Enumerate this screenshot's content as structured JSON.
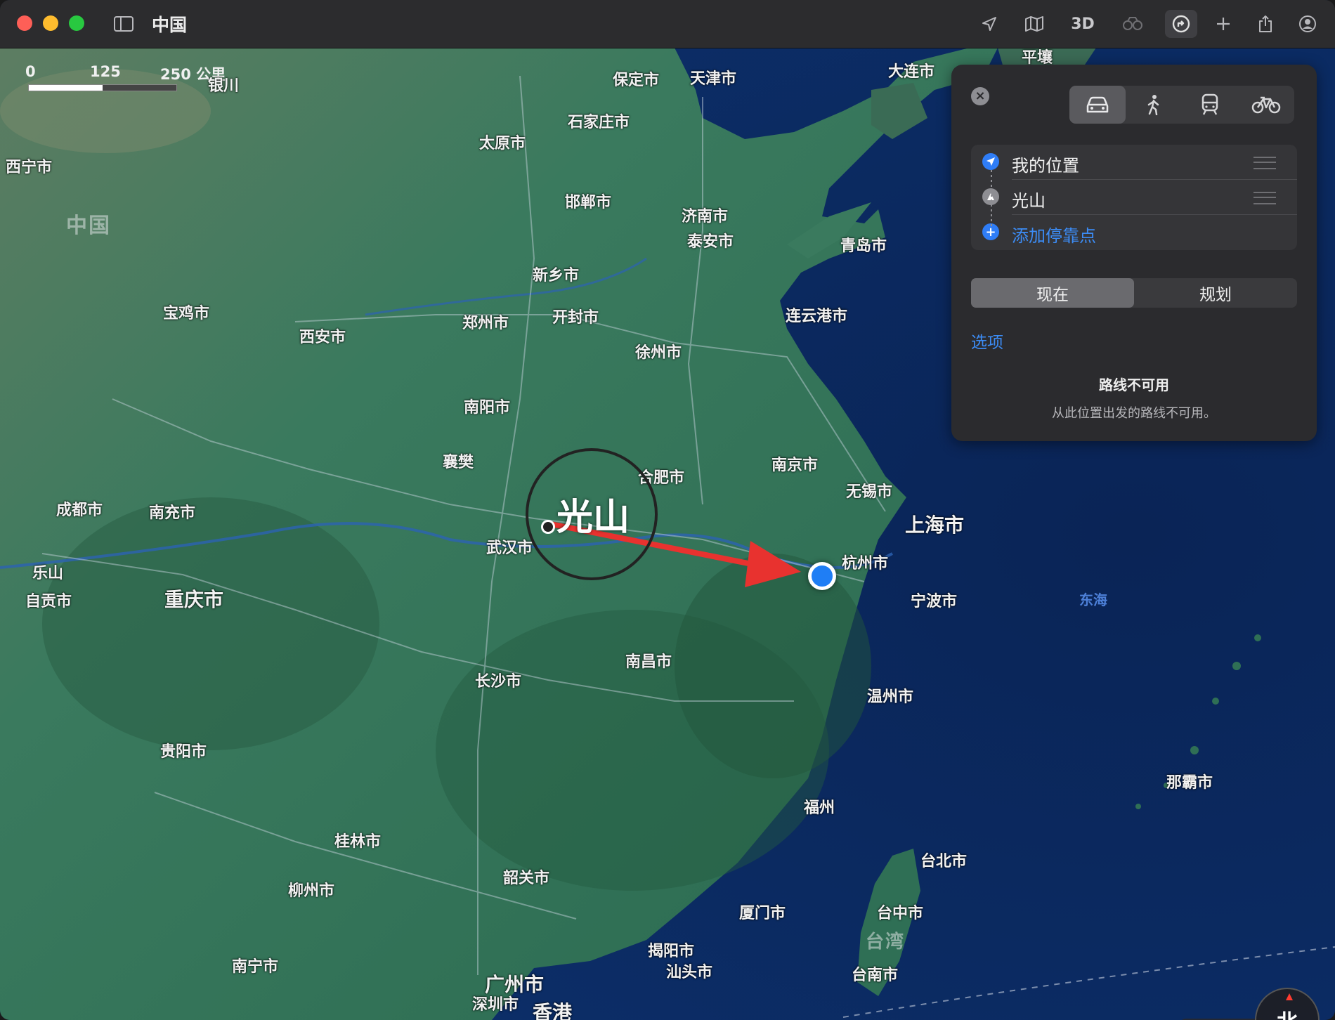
{
  "window": {
    "title": "中国",
    "view_3d_label": "3D"
  },
  "toolbar_icons": [
    "sidebar-icon",
    "location-arrow-icon",
    "map-mode-icon",
    "look-around-icon",
    "directions-icon",
    "add-icon",
    "share-icon",
    "account-icon"
  ],
  "map": {
    "scale": {
      "zero": "0",
      "mid": "125",
      "end": "250 公里"
    },
    "region_label": "中国",
    "sea_labels": [
      "东海"
    ],
    "cities": [
      {
        "name": "保定市"
      },
      {
        "name": "天津市"
      },
      {
        "name": "大连市"
      },
      {
        "name": "平壤"
      },
      {
        "name": "银川"
      },
      {
        "name": "石家庄市"
      },
      {
        "name": "太原市"
      },
      {
        "name": "西宁市"
      },
      {
        "name": "邯郸市"
      },
      {
        "name": "济南市"
      },
      {
        "name": "泰安市"
      },
      {
        "name": "青岛市"
      },
      {
        "name": "新乡市"
      },
      {
        "name": "宝鸡市"
      },
      {
        "name": "西安市"
      },
      {
        "name": "郑州市"
      },
      {
        "name": "开封市"
      },
      {
        "name": "连云港市"
      },
      {
        "name": "徐州市"
      },
      {
        "name": "南阳市"
      },
      {
        "name": "襄樊"
      },
      {
        "name": "合肥市"
      },
      {
        "name": "南京市"
      },
      {
        "name": "无锡市"
      },
      {
        "name": "上海市"
      },
      {
        "name": "成都市"
      },
      {
        "name": "南充市"
      },
      {
        "name": "武汉市"
      },
      {
        "name": "杭州市"
      },
      {
        "name": "乐山"
      },
      {
        "name": "自贡市"
      },
      {
        "name": "重庆市"
      },
      {
        "name": "宁波市"
      },
      {
        "name": "南昌市"
      },
      {
        "name": "长沙市"
      },
      {
        "name": "温州市"
      },
      {
        "name": "贵阳市"
      },
      {
        "name": "那霸市"
      },
      {
        "name": "福州"
      },
      {
        "name": "桂林市"
      },
      {
        "name": "台北市"
      },
      {
        "name": "韶关市"
      },
      {
        "name": "柳州市"
      },
      {
        "name": "厦门市"
      },
      {
        "name": "台中市"
      },
      {
        "name": "台湾"
      },
      {
        "name": "揭阳市"
      },
      {
        "name": "汕头市"
      },
      {
        "name": "台南市"
      },
      {
        "name": "南宁市"
      },
      {
        "name": "广州市"
      },
      {
        "name": "深圳市"
      },
      {
        "name": "香港"
      }
    ],
    "destination_label": "光山",
    "annotation_arrow_color": "#e8322f",
    "water_color": "#0b2b5e",
    "land_color": "#2f6b5a"
  },
  "directions_panel": {
    "modes": [
      {
        "name": "car-icon",
        "selected": true
      },
      {
        "name": "walk-icon",
        "selected": false
      },
      {
        "name": "transit-icon",
        "selected": false
      },
      {
        "name": "bike-icon",
        "selected": false
      }
    ],
    "stops": [
      {
        "label": "我的位置",
        "icon": "location-arrow-icon"
      },
      {
        "label": "光山",
        "icon": "landmark-icon"
      },
      {
        "label": "添加停靠点",
        "icon": "plus-icon"
      }
    ],
    "time_tabs": [
      "现在",
      "规划"
    ],
    "selected_time_tab": "现在",
    "options_label": "选项",
    "unavailable_title": "路线不可用",
    "unavailable_subtitle": "从此位置出发的路线不可用。"
  },
  "map_controls": {
    "zoom_out": "−",
    "zoom_in": "+",
    "compass_label": "北"
  }
}
